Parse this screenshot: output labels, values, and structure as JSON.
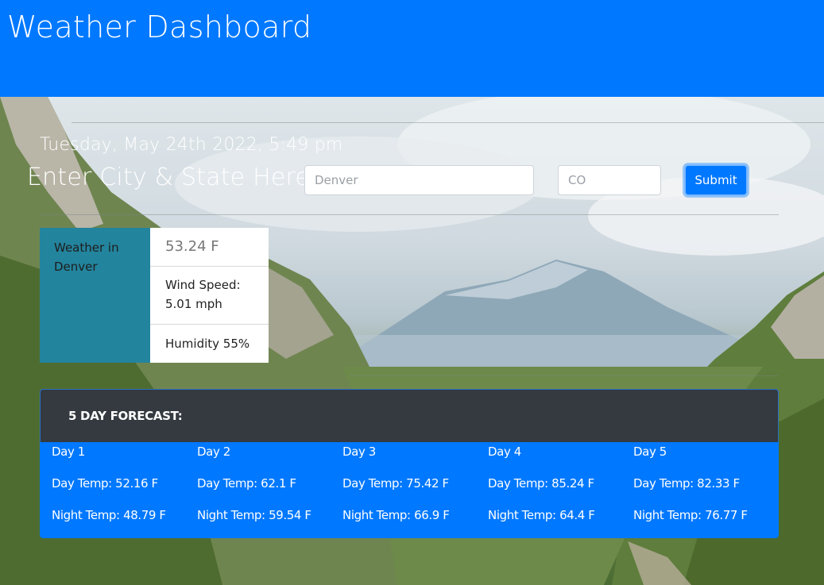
{
  "header": {
    "title": "Weather Dashboard"
  },
  "search": {
    "date_text": "Tuesday, May 24th 2022, 5:49 pm",
    "prompt": "Enter City & State Here:",
    "city_placeholder": "Denver",
    "state_placeholder": "CO",
    "submit_label": "Submit"
  },
  "current": {
    "city_label": "Weather in Denver",
    "temperature": "53.24 F",
    "wind_speed": "Wind Speed: 5.01 mph",
    "humidity": "Humidity 55%"
  },
  "forecast": {
    "heading": "5 DAY FORECAST:",
    "days": [
      {
        "label": "Day 1",
        "day_temp": "Day Temp: 52.16 F",
        "night_temp": "Night Temp: 48.79 F"
      },
      {
        "label": "Day 2",
        "day_temp": "Day Temp: 62.1 F",
        "night_temp": "Night Temp: 59.54 F"
      },
      {
        "label": "Day 3",
        "day_temp": "Day Temp: 75.42 F",
        "night_temp": "Night Temp: 66.9 F"
      },
      {
        "label": "Day 4",
        "day_temp": "Day Temp: 85.24 F",
        "night_temp": "Night Temp: 64.4 F"
      },
      {
        "label": "Day 5",
        "day_temp": "Day Temp: 82.33 F",
        "night_temp": "Night Temp: 76.77 F"
      }
    ]
  },
  "colors": {
    "header_bg": "#0078ff",
    "city_panel_bg": "#23849d",
    "forecast_header_bg": "#343a40",
    "forecast_bg": "#0078ff"
  }
}
